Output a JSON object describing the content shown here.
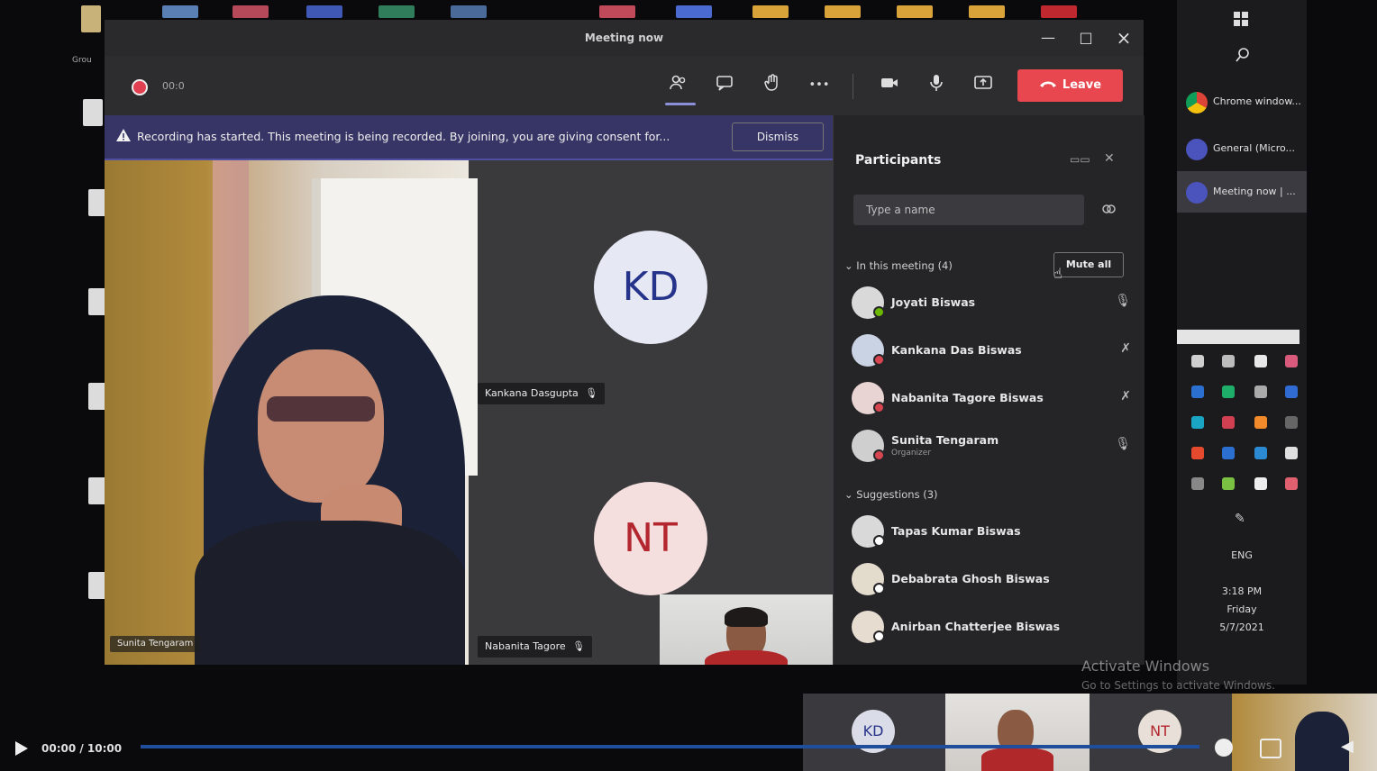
{
  "window": {
    "title": "Meeting now",
    "minimize_label": "—",
    "maximize_label": "□",
    "close_label": "×"
  },
  "toolbar": {
    "elapsed": "00:0",
    "leave_label": "Leave",
    "participants_icon": "people-icon",
    "chat_icon": "chat-icon",
    "raise_hand_icon": "hand-icon",
    "more_label": "•••",
    "camera_icon": "camera-icon",
    "mic_icon": "microphone-icon",
    "share_icon": "share-screen-icon"
  },
  "banner": {
    "text": "Recording has started. This meeting is being recorded. By joining, you are giving consent for...",
    "dismiss_label": "Dismiss"
  },
  "stage": {
    "main_name": "Sunita Tengaram",
    "tile1_initials": "KD",
    "tile1_name": "Kankana Dasgupta",
    "tile2_initials": "NT",
    "tile2_name": "Nabanita Tagore"
  },
  "panel": {
    "title": "Participants",
    "search_placeholder": "Type a name",
    "in_meeting_label": "In this meeting (4)",
    "mute_all_label": "Mute all",
    "in_meeting": [
      {
        "name": "Joyati Biswas",
        "status": "#6bb700"
      },
      {
        "name": "Kankana Das Biswas",
        "status": "#d64550"
      },
      {
        "name": "Nabanita Tagore Biswas",
        "status": "#d64550"
      },
      {
        "name": "Sunita Tengaram",
        "status": "#d64550",
        "sub": "Organizer"
      }
    ],
    "others_label": "Suggestions (3)",
    "others": [
      {
        "name": "Tapas Kumar Biswas"
      },
      {
        "name": "Debabrata Ghosh Biswas"
      },
      {
        "name": "Anirban Chatterjee Biswas"
      }
    ]
  },
  "rail": {
    "items": [
      {
        "label": "Chrome window...",
        "color": "#e8b13a"
      },
      {
        "label": "General (Micro...",
        "color": "#4b53bc"
      },
      {
        "label": "Meeting now | ...",
        "color": "#4b53bc"
      }
    ],
    "time": "3:18 PM",
    "day": "Friday",
    "date": "5/7/2021",
    "lang": "ENG"
  },
  "watermark": {
    "line1": "Activate Windows",
    "line2": "Go to Settings to activate Windows."
  },
  "player": {
    "time": "00:00 / 10:00",
    "thumb1_initials": "KD",
    "thumb3_initials": "NT"
  },
  "colors": {
    "accent": "#4b53bc",
    "leave": "#e8474f",
    "banner": "#363565",
    "progress": "#1e4e9c"
  }
}
